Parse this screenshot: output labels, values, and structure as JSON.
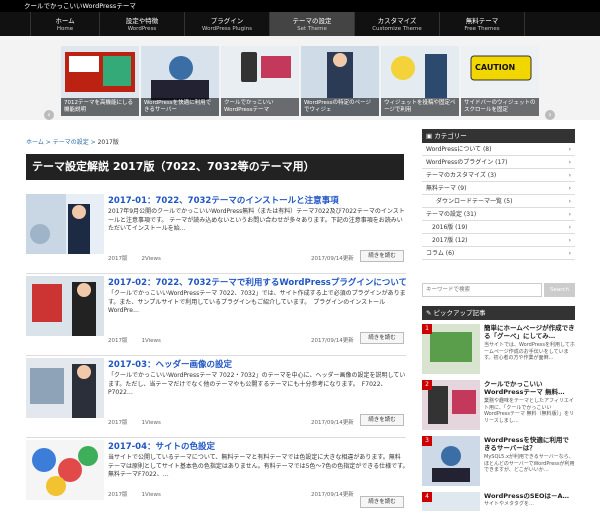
{
  "site": {
    "title": "クールでかっこいいWordPressテーマ"
  },
  "nav": [
    {
      "label": "ホーム",
      "sub": "Home"
    },
    {
      "label": "設定や特徴",
      "sub": "WordPress"
    },
    {
      "label": "プラグイン",
      "sub": "WordPress Plugins"
    },
    {
      "label": "テーマの設定",
      "sub": "Set Theme"
    },
    {
      "label": "カスタマイズ",
      "sub": "Customize Theme"
    },
    {
      "label": "無料テーマ",
      "sub": "Free Themes"
    }
  ],
  "slider": {
    "captions": [
      "7012テーマを高機能にしる機能説明",
      "WordPressを快適に利用できるサーバー",
      "クールでかっこいいWordPressテーマ",
      "WordPressの特定のページでウィジェ",
      "ウィジェットを投稿や固定ページで利用",
      "サイドバーのウィジェットのスクロールを固定"
    ],
    "banner_text": "CAUTION"
  },
  "breadcrumb": {
    "home": "ホーム",
    "sep": ">",
    "parent": "テーマの設定",
    "current": "2017版"
  },
  "page_title": "テーマ設定解説 2017版（7022、7032等のテーマ用）",
  "posts": [
    {
      "title": "2017-01：7022、7032テーマのインストールと注意事項",
      "excerpt": "2017年9月公開のクールでかっこいいWordPress無料（または有料）テーマ7022及び7022テーマのインストールと注意事項です。 テーマが読み込めないというお問い合わせが多々あります。下記の注意事項をお読みいただいてインストールを始…",
      "cat": "2017版",
      "views": "2Views",
      "date": "2017/09/14更新",
      "more": "続きを読む"
    },
    {
      "title": "2017-02：7022、7032テーマで利用するWordPressプラグインについて",
      "excerpt": "「クールでかっこいいWordPressテーマ 7022、7032」では、サイト作成する上で必須のプラグインがあります。また、サンプルサイトで利用しているプラグインもご紹介しています。　プラグインのインストール WordPre…",
      "cat": "2017版",
      "views": "1Views",
      "date": "2017/09/14更新",
      "more": "続きを読む"
    },
    {
      "title": "2017-03：ヘッダー画像の設定",
      "excerpt": "「クールでかっこいいWordPressテーマ 7022・7032」のテーマを中心に、ヘッダー画像の設定を説明しています。ただし、当テーマだけでなく他のテーマやも公開するテーマにも十分参考になります。　F7022、P7022…",
      "cat": "2017版",
      "views": "1Views",
      "date": "2017/09/14更新",
      "more": "続きを読む"
    },
    {
      "title": "2017-04：サイトの色設定",
      "excerpt": "当サイトで公開しているテーマについて、無料テーマと有料テーマでは色設定に大きな相違があります。無料テーマは原則としてサイト基本色の色指定はありません。有料テーマでは5色〜7色の色指定ができる仕様です。　無料テーマF7022、…",
      "cat": "2017版",
      "views": "1Views",
      "date": "2017/09/14更新",
      "more": "続きを読む"
    }
  ],
  "sidebar": {
    "category_heading": "カテゴリー",
    "categories": [
      {
        "label": "WordPressについて (8)"
      },
      {
        "label": "WordPressのプラグイン (17)"
      },
      {
        "label": "テーマのカスタマイズ (3)"
      },
      {
        "label": "無料テーマ (9)"
      },
      {
        "label": "ダウンロードテーマ一覧 (5)"
      },
      {
        "label": "テーマの設定 (31)"
      },
      {
        "label": "2016版 (19)"
      },
      {
        "label": "2017版 (12)"
      },
      {
        "label": "コラム (6)"
      }
    ],
    "search_placeholder": "キーワードで検索",
    "search_button": "Search",
    "pickup_heading": "ピックアップ記事",
    "pickups": [
      {
        "num": "1",
        "title": "簡単にホームページが作成できる「グーペ」にしてみ…",
        "desc": "当サイトでは、WordPressを利用してホームページ作成のお手伝いをしています。初心者の方や作業が面倒…"
      },
      {
        "num": "2",
        "title": "クールでかっこいいWordPressテーマ 無料…",
        "desc": "業務や趣味をテーマとしたアフィリエイト用に、「クールでかっこいいWordPressテーマ 無料（無料版）」をリリースしまし…"
      },
      {
        "num": "3",
        "title": "WordPressを快適に利用できるサーバーは？",
        "desc": "MySQL5.xが利用できるサーバーなら、ほとんどのサーバーでWordPressが利用できますが、どこがいいか…"
      },
      {
        "num": "4",
        "title": "WordPressのSEOは－A…",
        "desc": "サイトやメタタグを…"
      }
    ]
  }
}
